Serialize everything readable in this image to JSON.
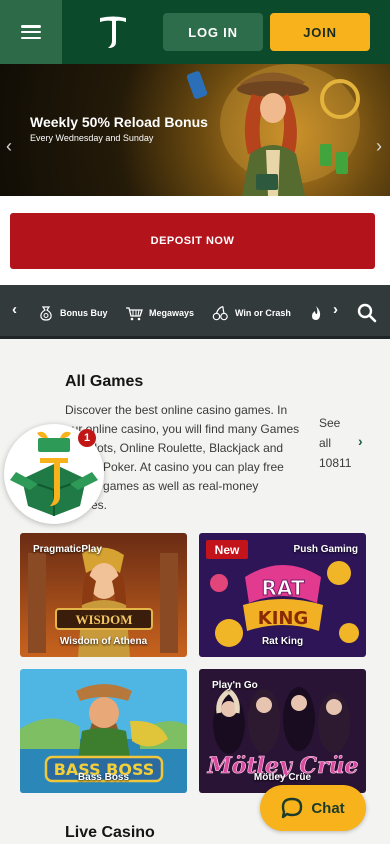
{
  "header": {
    "menu_icon": "hamburger-menu-icon",
    "logo_letter": "T",
    "login_label": "LOG IN",
    "join_label": "JOIN",
    "colors": {
      "header_bg": "#0c4a2c",
      "join_bg": "#f7b21c",
      "login_bg": "#2e6d4b"
    }
  },
  "hero": {
    "title": "Weekly 50% Reload Bonus",
    "subtitle": "Every Wednesday and Sunday",
    "prev_icon": "chevron-left-icon",
    "next_icon": "chevron-right-icon"
  },
  "deposit": {
    "label": "DEPOSIT NOW",
    "color": "#b3141c"
  },
  "categories": {
    "prev_icon": "chevron-left-icon",
    "next_icon": "chevron-right-icon",
    "items": [
      {
        "label": "Bonus Buy",
        "icon": "money-bag-icon"
      },
      {
        "label": "Megaways",
        "icon": "cart-icon"
      },
      {
        "label": "Win or Crash",
        "icon": "cherries-icon"
      },
      {
        "label": "",
        "icon": "flame-icon"
      }
    ],
    "search_icon": "search-icon"
  },
  "all_games": {
    "title": "All Games",
    "description": "Discover the best online casino games. In our online casino, you will find many Games like Slots, Online Roulette, Blackjack and Online Poker. At casino you can play free casino games as well as real-money Games.",
    "see_all_line1": "See",
    "see_all_line2": "all",
    "count": "10811"
  },
  "gift": {
    "badge": "1",
    "icon": "gift-box-icon"
  },
  "games": [
    {
      "name": "Wisdom of Athena",
      "provider": "PragmaticPlay",
      "badge": ""
    },
    {
      "name": "Rat King",
      "provider": "Push Gaming",
      "badge": "New"
    },
    {
      "name": "Bass Boss",
      "provider": "",
      "badge": ""
    },
    {
      "name": "Mötley Crüe",
      "provider": "Play'n Go",
      "badge": ""
    }
  ],
  "live_casino": {
    "title": "Live Casino"
  },
  "chat": {
    "label": "Chat",
    "icon": "chat-bubble-icon"
  }
}
